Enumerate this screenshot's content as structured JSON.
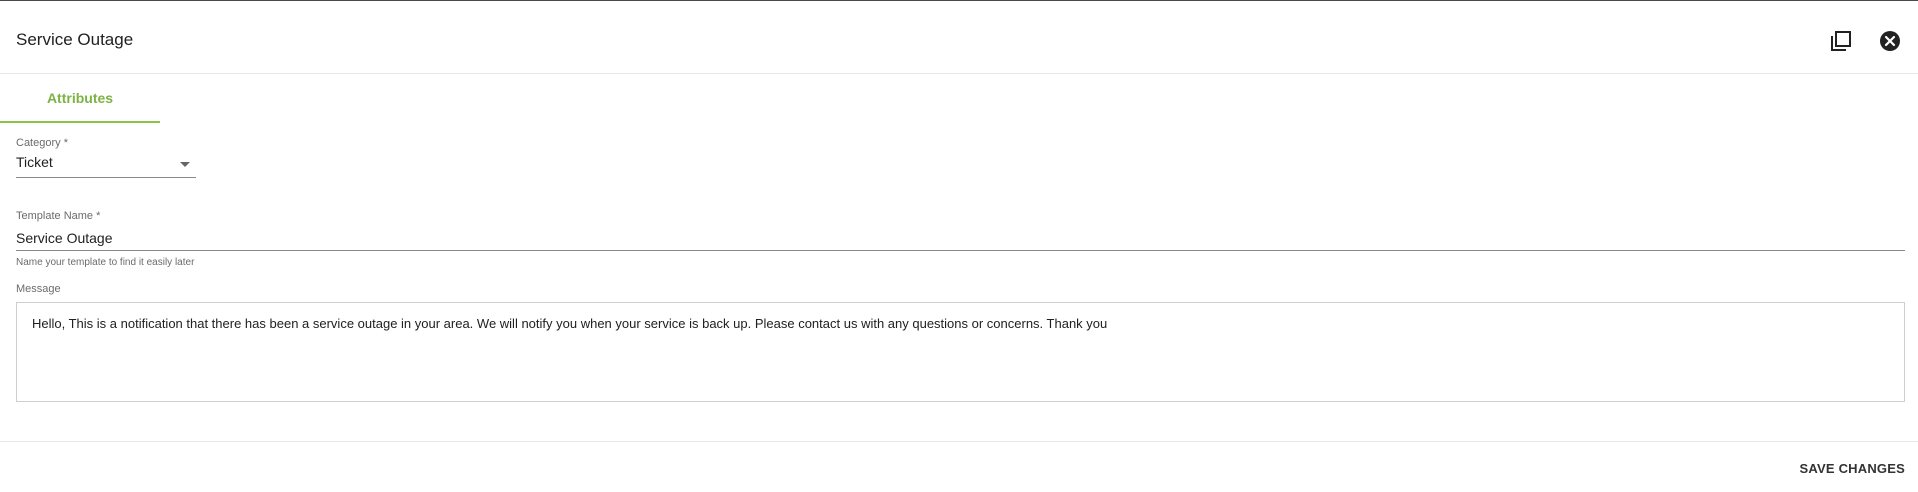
{
  "dialog": {
    "title": "Service Outage",
    "icons": {
      "maximize": "maximize-window-icon",
      "close": "close-circle-icon"
    }
  },
  "tabs": [
    {
      "label": "Attributes",
      "active": true
    }
  ],
  "form": {
    "category": {
      "label": "Category *",
      "value": "Ticket"
    },
    "template_name": {
      "label": "Template Name *",
      "value": "Service Outage",
      "helper": "Name your template to find it easily later"
    },
    "message": {
      "label": "Message",
      "value": "Hello, This is a notification that there has been a service outage in your area. We will notify you when your service is back up. Please contact us with any questions or concerns. Thank you"
    }
  },
  "footer": {
    "save_label": "SAVE CHANGES"
  },
  "colors": {
    "accent": "#8bc34a",
    "text": "#212121",
    "muted": "#6b6b6b"
  }
}
